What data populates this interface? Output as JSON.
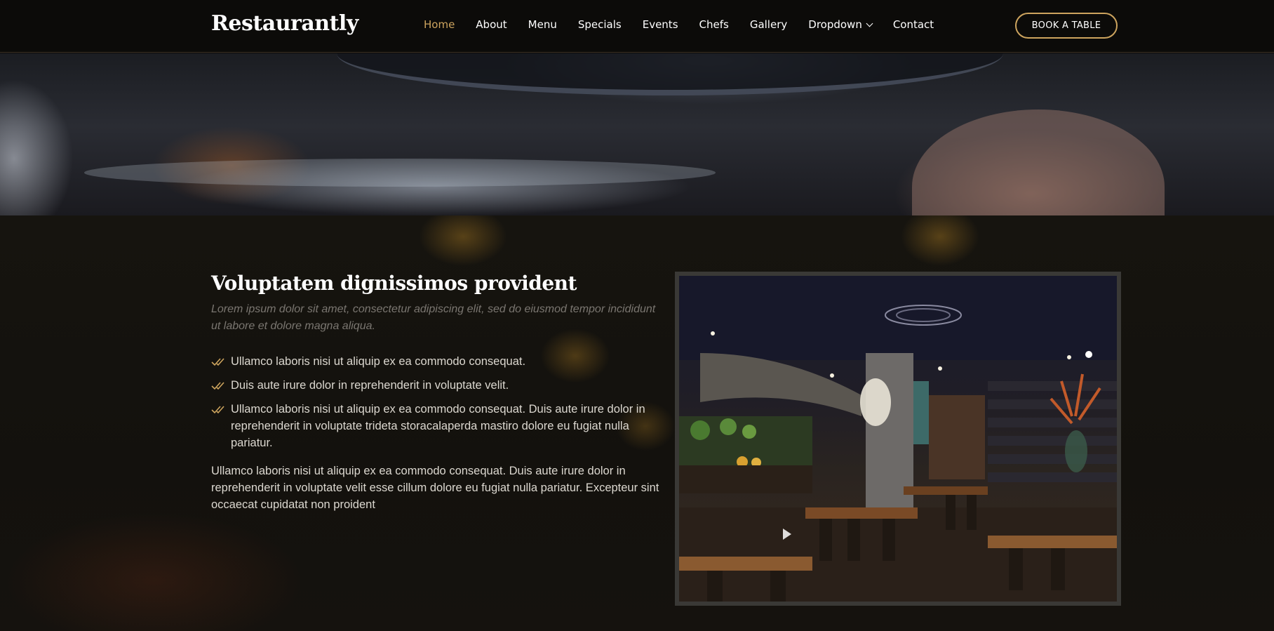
{
  "header": {
    "logo": "Restaurantly",
    "nav": [
      {
        "label": "Home",
        "active": true
      },
      {
        "label": "About",
        "active": false
      },
      {
        "label": "Menu",
        "active": false
      },
      {
        "label": "Specials",
        "active": false
      },
      {
        "label": "Events",
        "active": false
      },
      {
        "label": "Chefs",
        "active": false
      },
      {
        "label": "Gallery",
        "active": false
      },
      {
        "label": "Dropdown",
        "active": false,
        "icon": "chevron-down-icon"
      },
      {
        "label": "Contact",
        "active": false
      }
    ],
    "cta": "BOOK A TABLE"
  },
  "about": {
    "title": "Voluptatem dignissimos provident",
    "lead": "Lorem ipsum dolor sit amet, consectetur adipiscing elit, sed do eiusmod tempor incididunt ut labore et dolore magna aliqua.",
    "features": [
      "Ullamco laboris nisi ut aliquip ex ea commodo consequat.",
      "Duis aute irure dolor in reprehenderit in voluptate velit.",
      "Ullamco laboris nisi ut aliquip ex ea commodo consequat. Duis aute irure dolor in reprehenderit in voluptate trideta storacalaperda mastiro dolore eu fugiat nulla pariatur."
    ],
    "feature_icon": "double-check-icon",
    "paragraph": "Ullamco laboris nisi ut aliquip ex ea commodo consequat. Duis aute irure dolor in reprehenderit in voluptate velit esse cillum dolore eu fugiat nulla pariatur. Excepteur sint occaecat cupidatat non proident"
  },
  "colors": {
    "accent": "#cda45e",
    "background": "#0c0b09",
    "text": "#ffffff",
    "muted_text": "#7a7670"
  }
}
